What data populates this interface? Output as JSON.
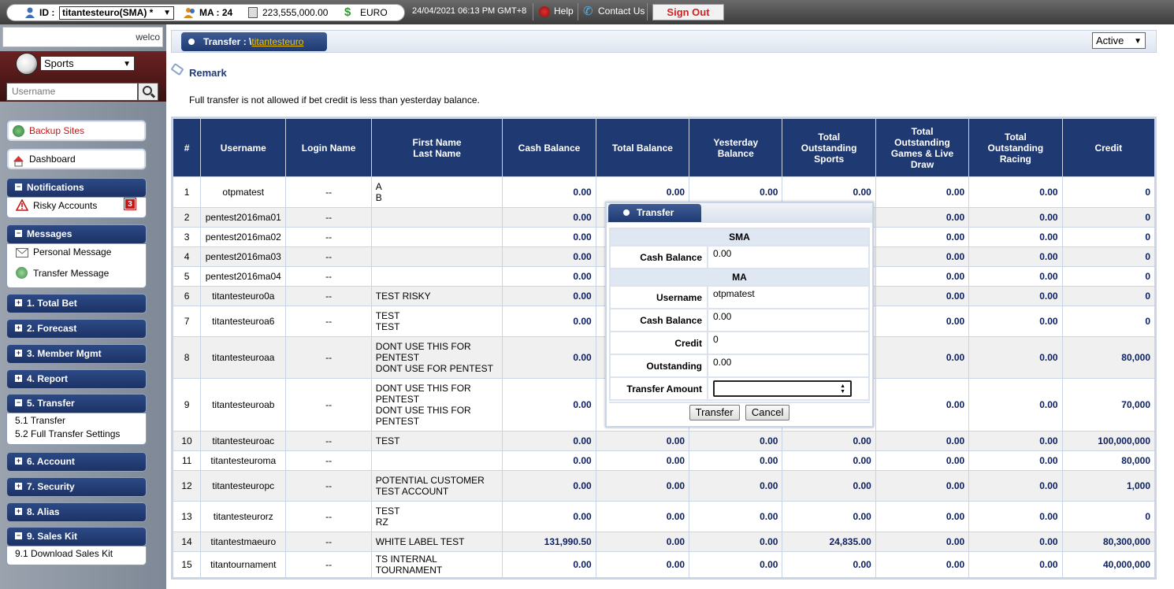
{
  "topbar": {
    "id_label": "ID :",
    "id_value": "titantesteuro(SMA) *",
    "ma_label": "MA : 24",
    "balance": "223,555,000.00",
    "currency": "EURO",
    "datetime": "24/04/2021 06:13 PM GMT+8",
    "help": "Help",
    "contact": "Contact Us",
    "signout": "Sign Out"
  },
  "sidebar": {
    "marquee": "welco",
    "sport": "Sports",
    "username_placeholder": "Username",
    "backup_sites": "Backup Sites",
    "dashboard": "Dashboard",
    "notifications": {
      "title": "Notifications",
      "risky": "Risky Accounts",
      "risky_count": "3"
    },
    "messages": {
      "title": "Messages",
      "personal": "Personal Message",
      "transfer": "Transfer Message"
    },
    "menu": {
      "total_bet": "1. Total Bet",
      "forecast": "2. Forecast",
      "member_mgmt": "3. Member Mgmt",
      "report": "4. Report",
      "transfer": "5. Transfer",
      "transfer_items": [
        "5.1 Transfer",
        "5.2 Full Transfer Settings"
      ],
      "account": "6. Account",
      "security": "7. Security",
      "alias": "8. Alias",
      "sales_kit": "9. Sales Kit",
      "sales_kit_items": [
        "9.1 Download Sales Kit"
      ]
    }
  },
  "header": {
    "breadcrumb_prefix": "Transfer : \\",
    "breadcrumb_link": "titantesteuro",
    "status": "Active"
  },
  "remark": {
    "title": "Remark",
    "text": "Full transfer is not allowed if bet credit is less than yesterday balance."
  },
  "table": {
    "headers": [
      "#",
      "Username",
      "Login Name",
      "First Name\nLast Name",
      "Cash Balance",
      "Total Balance",
      "Yesterday\nBalance",
      "Total\nOutstanding\nSports",
      "Total\nOutstanding\nGames & Live\nDraw",
      "Total\nOutstanding\nRacing",
      "Credit"
    ],
    "rows": [
      [
        "1",
        "otpmatest",
        "--",
        "A\nB",
        "0.00",
        "0.00",
        "0.00",
        "0.00",
        "0.00",
        "0.00",
        "0"
      ],
      [
        "2",
        "pentest2016ma01",
        "--",
        "",
        "0.00",
        "",
        "",
        "",
        "0.00",
        "0.00",
        "0"
      ],
      [
        "3",
        "pentest2016ma02",
        "--",
        "",
        "0.00",
        "",
        "",
        "",
        "0.00",
        "0.00",
        "0"
      ],
      [
        "4",
        "pentest2016ma03",
        "--",
        "",
        "0.00",
        "",
        "",
        "",
        "0.00",
        "0.00",
        "0"
      ],
      [
        "5",
        "pentest2016ma04",
        "--",
        "",
        "0.00",
        "",
        "",
        "",
        "0.00",
        "0.00",
        "0"
      ],
      [
        "6",
        "titantesteuro0a",
        "--",
        "TEST RISKY",
        "0.00",
        "",
        "",
        "",
        "0.00",
        "0.00",
        "0"
      ],
      [
        "7",
        "titantesteuroa6",
        "--",
        "TEST\nTEST",
        "0.00",
        "",
        "",
        "",
        "0.00",
        "0.00",
        "0"
      ],
      [
        "8",
        "titantesteuroaa",
        "--",
        "DONT USE THIS FOR\nPENTEST\nDONT USE FOR PENTEST",
        "0.00",
        "",
        "",
        "",
        "0.00",
        "0.00",
        "80,000"
      ],
      [
        "9",
        "titantesteuroab",
        "--",
        "DONT USE THIS FOR\nPENTEST\nDONT USE THIS FOR\nPENTEST",
        "0.00",
        "",
        "",
        "",
        "0.00",
        "0.00",
        "70,000"
      ],
      [
        "10",
        "titantesteuroac",
        "--",
        "TEST",
        "0.00",
        "0.00",
        "0.00",
        "0.00",
        "0.00",
        "0.00",
        "100,000,000"
      ],
      [
        "11",
        "titantesteuroma",
        "--",
        "",
        "0.00",
        "0.00",
        "0.00",
        "0.00",
        "0.00",
        "0.00",
        "80,000"
      ],
      [
        "12",
        "titantesteuropc",
        "--",
        "POTENTIAL CUSTOMER\nTEST ACCOUNT",
        "0.00",
        "0.00",
        "0.00",
        "0.00",
        "0.00",
        "0.00",
        "1,000"
      ],
      [
        "13",
        "titantesteurorz",
        "--",
        "TEST\nRZ",
        "0.00",
        "0.00",
        "0.00",
        "0.00",
        "0.00",
        "0.00",
        "0"
      ],
      [
        "14",
        "titantestmaeuro",
        "--",
        "WHITE LABEL TEST",
        "131,990.50",
        "0.00",
        "0.00",
        "24,835.00",
        "0.00",
        "0.00",
        "80,300,000"
      ],
      [
        "15",
        "titantournament",
        "--",
        "TS INTERNAL TOURNAMENT",
        "0.00",
        "0.00",
        "0.00",
        "0.00",
        "0.00",
        "0.00",
        "40,000,000"
      ]
    ]
  },
  "dialog": {
    "title": "Transfer",
    "sma_section": "SMA",
    "sma_cash_label": "Cash Balance",
    "sma_cash_value": "0.00",
    "ma_section": "MA",
    "username_label": "Username",
    "username_value": "otpmatest",
    "ma_cash_label": "Cash Balance",
    "ma_cash_value": "0.00",
    "credit_label": "Credit",
    "credit_value": "0",
    "outstanding_label": "Outstanding",
    "outstanding_value": "0.00",
    "amount_label": "Transfer Amount",
    "amount_value": "",
    "transfer_button": "Transfer",
    "cancel_button": "Cancel"
  },
  "colors": {
    "header_blue": "#1f3a72",
    "value_navy": "#0b1f5e",
    "signout_red": "#d21f1f",
    "link_yellow": "#f2c200",
    "badge_red": "#c41818"
  }
}
